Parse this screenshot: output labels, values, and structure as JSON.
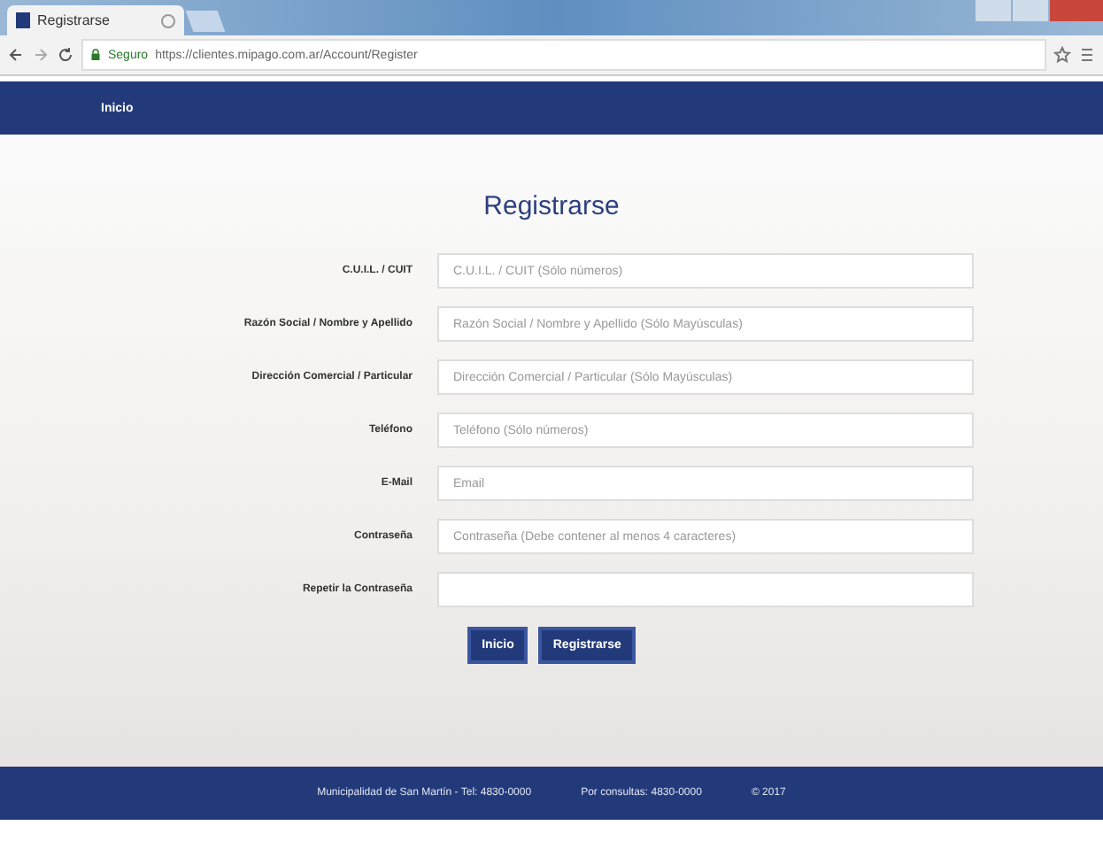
{
  "browser": {
    "tab_title": "Registrarse",
    "secure_label": "Seguro",
    "url": "https://clientes.mipago.com.ar/Account/Register"
  },
  "nav": {
    "home_link": "Inicio"
  },
  "form": {
    "title": "Registrarse",
    "fields": [
      {
        "label": "C.U.I.L. / CUIT",
        "placeholder": "C.U.I.L. / CUIT (Sólo números)"
      },
      {
        "label": "Razón Social / Nombre y Apellido",
        "placeholder": "Razón Social / Nombre y Apellido (Sólo Mayúsculas)"
      },
      {
        "label": "Dirección Comercial / Particular",
        "placeholder": "Dirección Comercial / Particular (Sólo Mayúsculas)"
      },
      {
        "label": "Teléfono",
        "placeholder": "Teléfono (Sólo números)"
      },
      {
        "label": "E-Mail",
        "placeholder": "Email"
      },
      {
        "label": "Contraseña",
        "placeholder": "Contraseña (Debe contener al menos 4 caracteres)"
      },
      {
        "label": "Repetir la Contraseña"
      }
    ],
    "buttons": [
      "Inicio",
      "Registrarse"
    ]
  },
  "footer": {
    "items": [
      "Municipalidad de San Martín - Tel: 4830-0000",
      "Por consultas: 4830-0000",
      "© 2017"
    ]
  }
}
